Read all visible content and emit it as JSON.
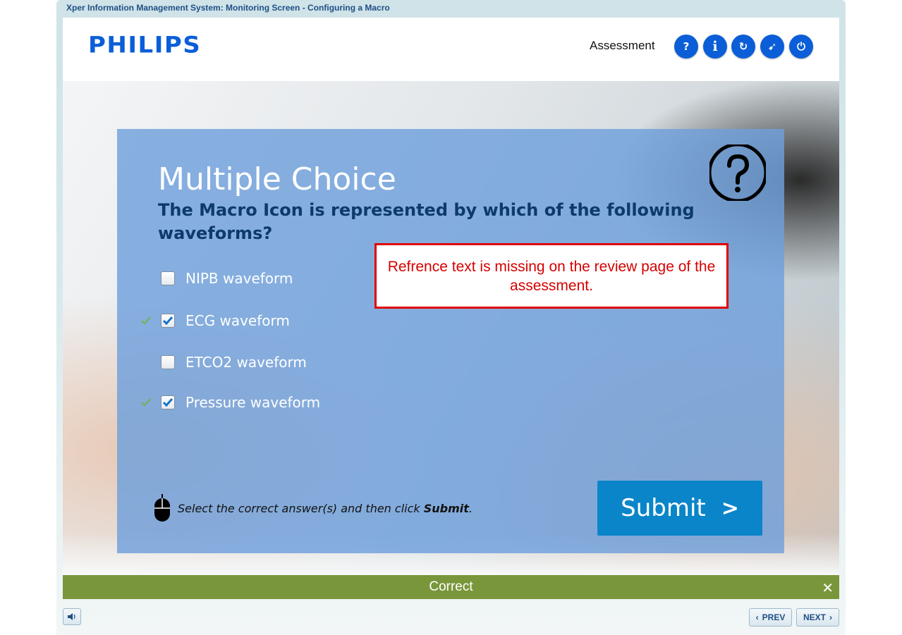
{
  "window": {
    "title": "Xper Information Management System: Monitoring Screen - Configuring a Macro"
  },
  "header": {
    "logo": "PHILIPS",
    "section_label": "Assessment",
    "buttons": [
      {
        "name": "help",
        "glyph": "?"
      },
      {
        "name": "info",
        "glyph": "i"
      },
      {
        "name": "replay",
        "glyph": "↻"
      },
      {
        "name": "navigation",
        "glyph": "➹"
      },
      {
        "name": "exit",
        "glyph": "⏻"
      }
    ]
  },
  "question": {
    "type_title": "Multiple Choice",
    "prompt": "The Macro Icon is represented by which of the following waveforms?",
    "options": [
      {
        "label": "NIPB waveform",
        "checked": false,
        "correct_mark": false
      },
      {
        "label": "ECG waveform",
        "checked": true,
        "correct_mark": true
      },
      {
        "label": "ETCO2 waveform",
        "checked": false,
        "correct_mark": false
      },
      {
        "label": "Pressure waveform",
        "checked": true,
        "correct_mark": true
      }
    ],
    "instruction_prefix": "Select the correct answer(s) and then click ",
    "instruction_bold": "Submit",
    "instruction_suffix": ".",
    "submit_label": "Submit",
    "submit_arrow": ">"
  },
  "callout": {
    "text": "Refrence text is missing on the review page of the assessment."
  },
  "feedback": {
    "message": "Correct",
    "close_glyph": "✕"
  },
  "footer": {
    "prev_label": "PREV",
    "next_label": "NEXT"
  },
  "colors": {
    "brand_blue": "#0b5ed7",
    "submit_blue": "#0a85c9",
    "feedback_green": "#7a963b",
    "callout_red": "#e00000"
  }
}
